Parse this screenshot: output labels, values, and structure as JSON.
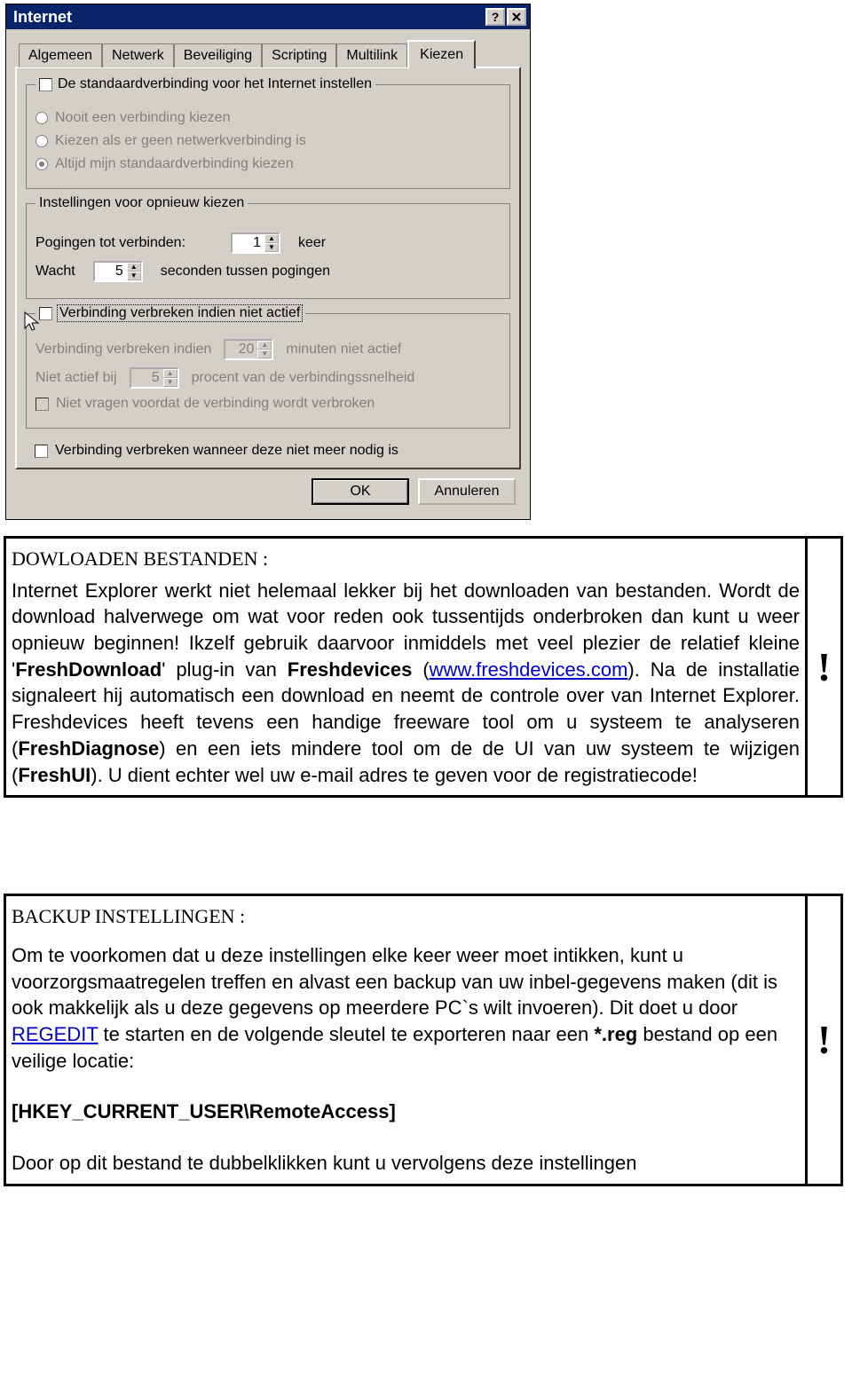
{
  "dialog": {
    "title": "Internet",
    "tabs": [
      "Algemeen",
      "Netwerk",
      "Beveiliging",
      "Scripting",
      "Multilink",
      "Kiezen"
    ],
    "active_tab": 5,
    "group1": {
      "legend": "De standaardverbinding voor het Internet instellen",
      "radios": [
        "Nooit een verbinding kiezen",
        "Kiezen als er geen netwerkverbinding is",
        "Altijd mijn standaardverbinding kiezen"
      ]
    },
    "group2": {
      "legend": "Instellingen voor opnieuw kiezen",
      "row1_a": "Pogingen tot verbinden:",
      "row1_val": "1",
      "row1_b": "keer",
      "row2_a": "Wacht",
      "row2_val": "5",
      "row2_b": "seconden tussen pogingen"
    },
    "group3": {
      "legend": "Verbinding verbreken indien niet actief",
      "row1_a": "Verbinding verbreken indien",
      "row1_val": "20",
      "row1_b": "minuten niet actief",
      "row2_a": "Niet actief bij",
      "row2_val": "5",
      "row2_b": "procent van de verbindingssnelheid",
      "row3": "Niet vragen voordat de verbinding wordt verbroken"
    },
    "final_check": "Verbinding verbreken wanneer deze niet meer nodig is",
    "ok": "OK",
    "cancel": "Annuleren"
  },
  "download_box": {
    "heading": "DOWLOADEN BESTANDEN :",
    "p1": "Internet Explorer werkt niet helemaal lekker bij het downloaden van bestanden. Wordt de download halverwege om wat voor reden ook tussentijds onderbroken dan kunt u weer opnieuw beginnen! Ikzelf gebruik daarvoor inmiddels met veel plezier de relatief kleine '",
    "fresh": "FreshDownload",
    "p2": "' plug-in van ",
    "fdev": "Freshdevices",
    "p3": " (",
    "link": "www.freshdevices.com",
    "p4": "). Na de installatie signaleert hij automatisch een download en neemt de controle over van Internet Explorer. Freshdevices heeft tevens een handige freeware tool om u systeem te analyseren (",
    "diag": "FreshDiagnose",
    "p5": ") en een iets mindere tool om de de UI van uw systeem te wijzigen (",
    "ui": "FreshUI",
    "p6": "). U dient echter wel uw e-mail adres te geven voor de registratiecode!",
    "bang": "!"
  },
  "backup_box": {
    "heading": "BACKUP INSTELLINGEN :",
    "p1": "Om te voorkomen dat u deze instellingen elke keer weer moet intikken, kunt u voorzorgsmaatregelen treffen en alvast een backup van uw inbel-gegevens maken (dit is ook makkelijk als u deze gegevens op meerdere PC`s wilt invoeren). Dit doet u door ",
    "regedit": "REGEDIT",
    "p2": " te starten en de volgende sleutel te exporteren naar een ",
    "reg": "*.reg",
    "p3": " bestand op een veilige locatie:",
    "key": "[HKEY_CURRENT_USER\\RemoteAccess]",
    "p4": "Door op dit bestand te dubbelklikken kunt u vervolgens deze instellingen",
    "bang": "!"
  }
}
